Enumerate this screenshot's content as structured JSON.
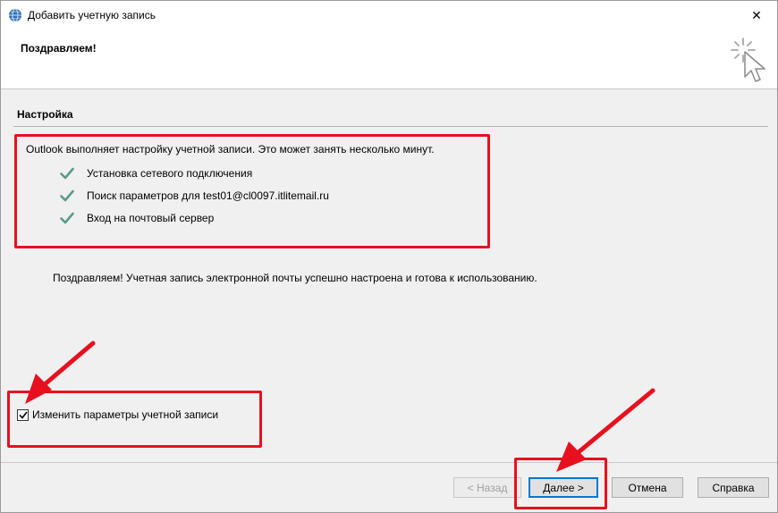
{
  "window": {
    "title": "Добавить учетную запись",
    "close_glyph": "✕"
  },
  "header": {
    "title": "Поздравляем!"
  },
  "section": {
    "title": "Настройка",
    "intro": "Outlook выполняет настройку учетной записи. Это может занять несколько минут.",
    "steps": [
      {
        "label": "Установка сетевого подключения",
        "status": "done"
      },
      {
        "label": "Поиск параметров для test01@cl0097.itlitemail.ru",
        "status": "done"
      },
      {
        "label": "Вход на почтовый сервер",
        "status": "done"
      }
    ],
    "success_message": "Поздравляем! Учетная запись электронной почты успешно настроена и готова к использованию."
  },
  "options": {
    "change_settings_label": "Изменить параметры учетной записи",
    "change_settings_checked": true
  },
  "buttons": {
    "back_label": "< Назад",
    "back_enabled": false,
    "next_label": "Далее >",
    "cancel_label": "Отмена",
    "help_label": "Справка"
  },
  "colors": {
    "check_mark": "#5b9a8b",
    "annotation": "#e8101e",
    "focus_border": "#0078d7"
  },
  "icons": {
    "app": "outlook-globe-icon",
    "header": "magic-wand-cursor-icon",
    "step": "checkmark-icon"
  }
}
